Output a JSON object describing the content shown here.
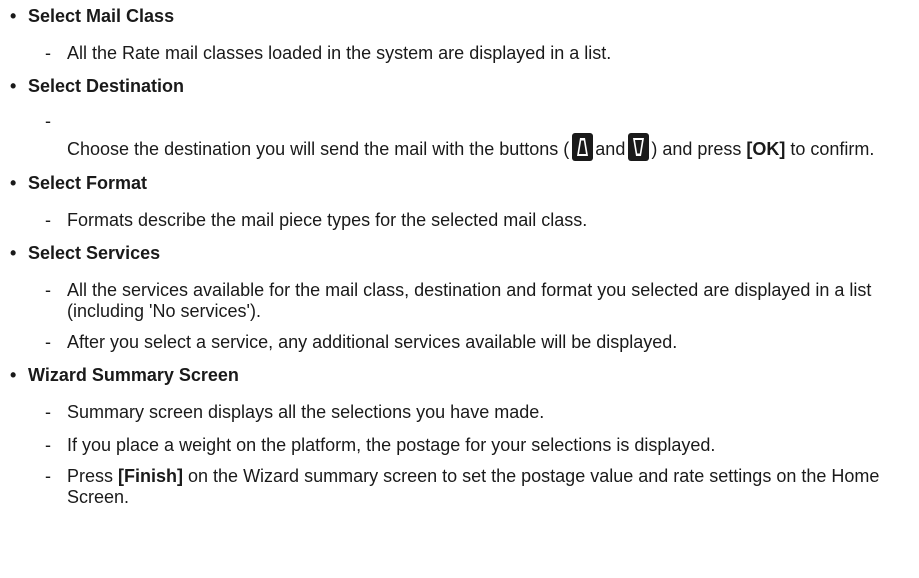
{
  "bullet_glyph": "•",
  "dash_glyph": "-",
  "sections": {
    "mail_class": {
      "title": "Select Mail Class",
      "items": [
        "All the Rate mail classes loaded in the system are displayed in a list."
      ]
    },
    "destination": {
      "title": "Select Destination",
      "text_before_buttons": "Choose the destination you will send the mail with the buttons (",
      "and_text": "and",
      "text_after_buttons": ") and press ",
      "ok_label": "[OK]",
      "text_end": " to confirm.",
      "buttons": [
        "up-arrow-button-icon",
        "down-arrow-button-icon"
      ]
    },
    "format": {
      "title": "Select Format",
      "items": [
        "Formats describe the mail piece types for the selected mail class."
      ]
    },
    "services": {
      "title": "Select Services",
      "items": [
        "All the services available for the mail class, destination and format you selected are displayed in a list (including 'No services').",
        "After you select a service, any additional services available will be displayed."
      ]
    },
    "summary": {
      "title": "Wizard Summary Screen",
      "items": [
        "Summary screen displays all the selections you have made.",
        "If you place a weight on the platform, the postage for your selections is displayed."
      ],
      "finish_prefix": "Press ",
      "finish_label": "[Finish]",
      "finish_suffix": " on the Wizard summary screen to set the postage value and rate settings on the Home Screen."
    }
  },
  "colors": {
    "text": "#1a1a1a",
    "button_fill": "#1a1a1a",
    "button_glyph": "#ffffff"
  }
}
